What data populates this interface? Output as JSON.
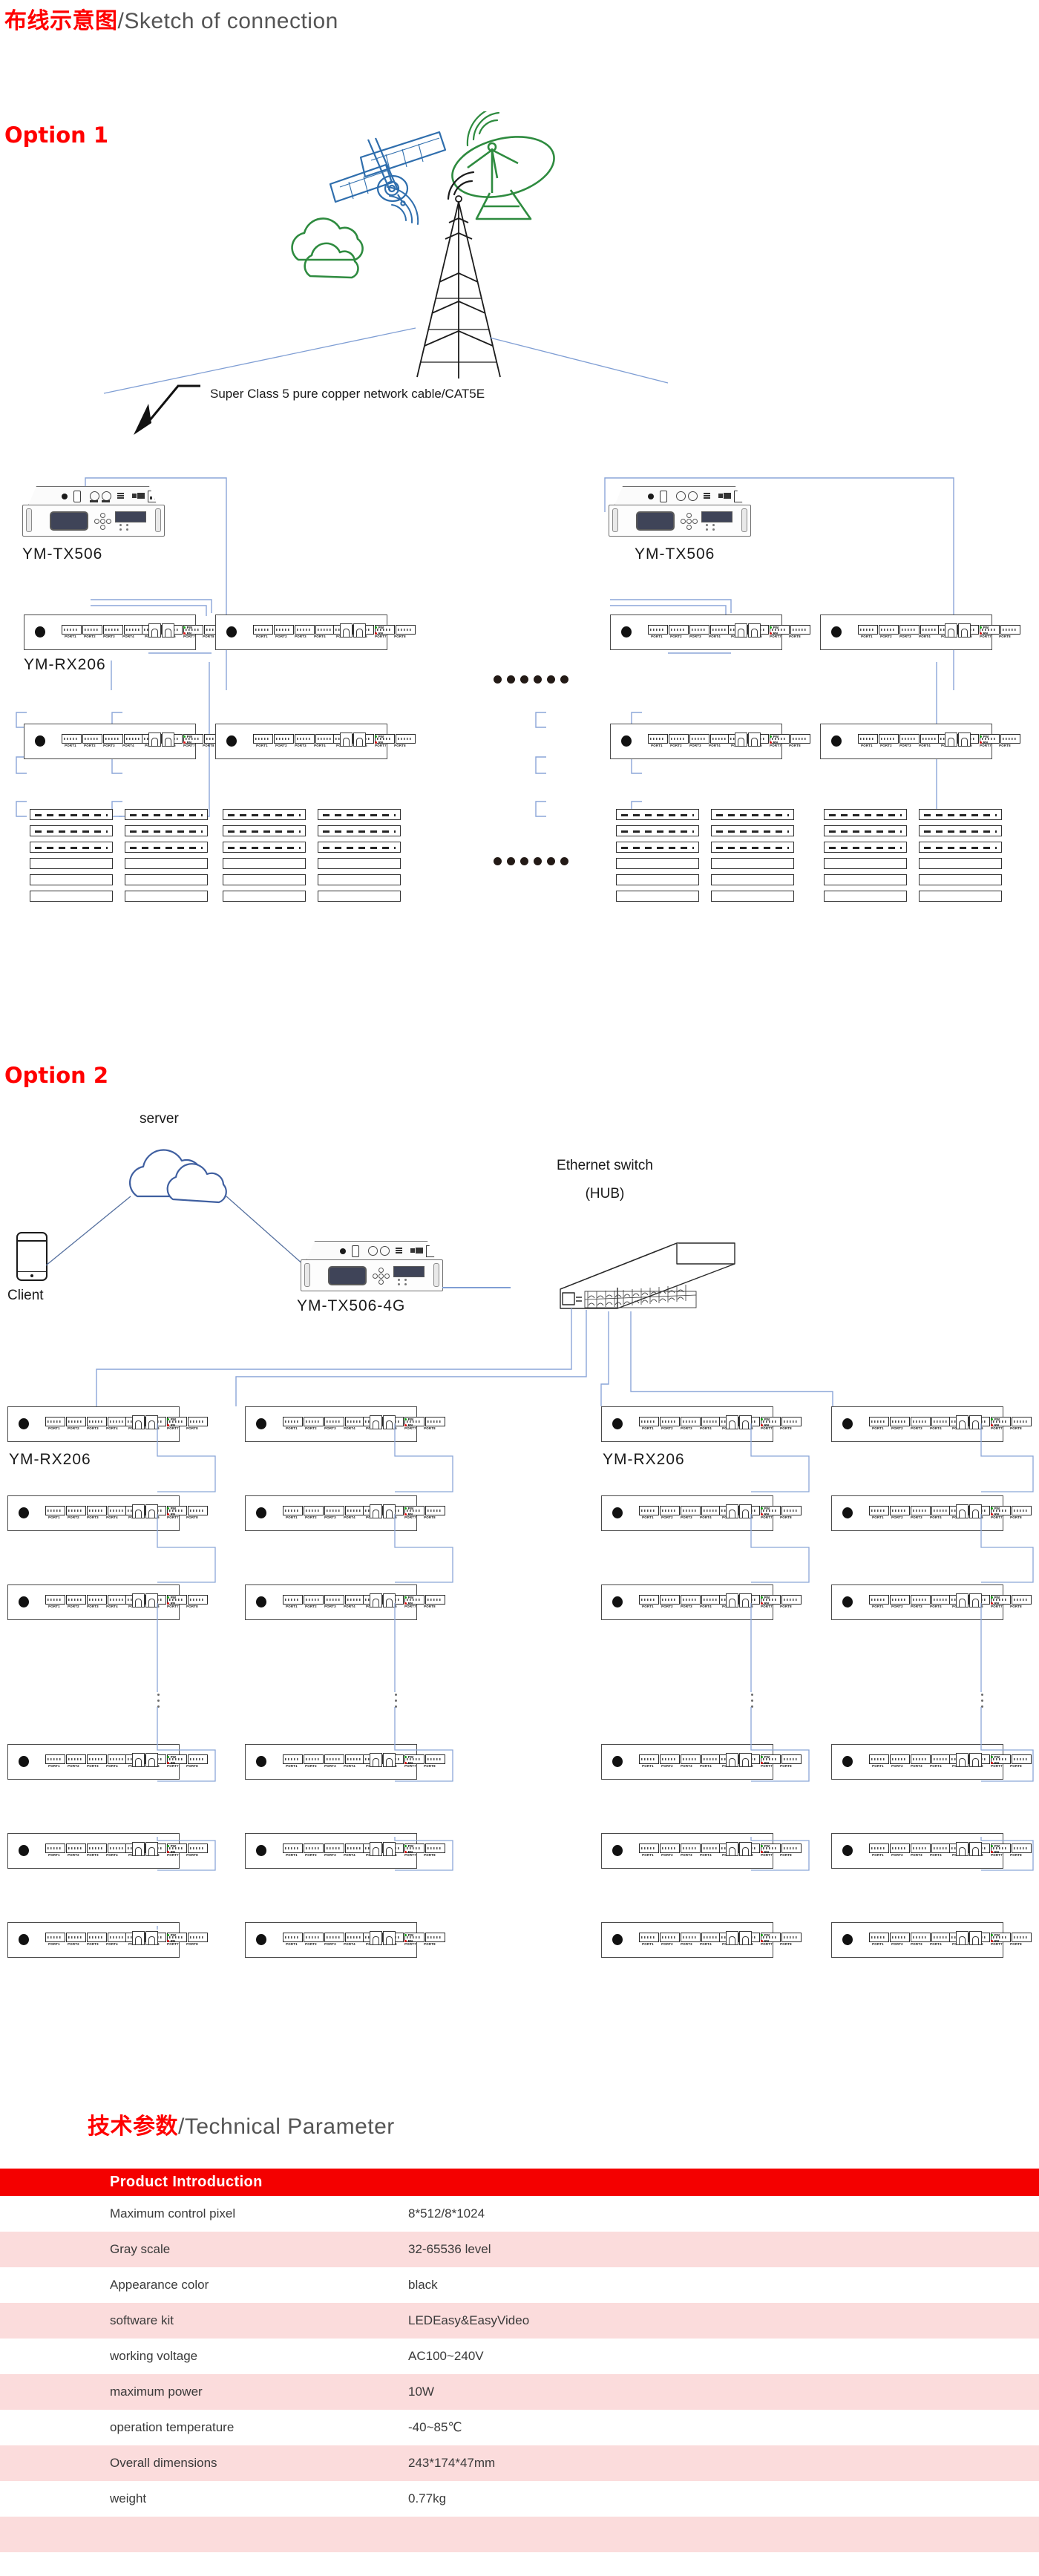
{
  "page_title": {
    "cn": "布线示意图",
    "en": "/Sketch of connection"
  },
  "tech_title": {
    "cn": "技术参数",
    "en": "/Technical Parameter"
  },
  "option1": {
    "label": "Option 1",
    "cable_note": "Super Class 5 pure copper network cable/CAT5E",
    "sender_label": "YM-TX506",
    "sender_label_right": "YM-TX506",
    "receiver_label": "YM-RX206",
    "ellipsis": "••••••"
  },
  "option2": {
    "label": "Option 2",
    "server_label": "server",
    "client_label": "Client",
    "sender_label": "YM-TX506-4G",
    "switch_label_line1": "Ethernet switch",
    "switch_label_line2": "(HUB)",
    "receiver_label_left": "YM-RX206",
    "receiver_label_right": "YM-RX206"
  },
  "rx_card": {
    "ports": [
      "PORT1",
      "PORT2",
      "PORT3",
      "PORT4",
      "PORT5",
      "PORT6",
      "PORT7",
      "PORT8"
    ],
    "status": [
      "PW",
      "RN"
    ],
    "status_colors": [
      "#19a319",
      "#e11515"
    ]
  },
  "colors": {
    "accent_red": "#ff0000",
    "table_header_red": "#f40000",
    "table_alt_row": "#fbdcdc",
    "wire_blue": "#7f9ed4",
    "satellite_blue": "#2f6ead",
    "dish_green": "#2e8b3f"
  },
  "table": {
    "header": "Product Introduction",
    "rows": [
      {
        "name": "Maximum control pixel",
        "value": "8*512/8*1024"
      },
      {
        "name": "Gray scale",
        "value": "32-65536 level"
      },
      {
        "name": "Appearance color",
        "value": "black"
      },
      {
        "name": "software kit",
        "value": "LEDEasy&EasyVideo"
      },
      {
        "name": "working voltage",
        "value": "AC100~240V"
      },
      {
        "name": "maximum power",
        "value": "10W"
      },
      {
        "name": "operation temperature",
        "value": "-40~85℃"
      },
      {
        "name": "Overall dimensions",
        "value": "243*174*47mm"
      },
      {
        "name": "weight",
        "value": "0.77kg"
      },
      {
        "name": "",
        "value": ""
      }
    ]
  }
}
